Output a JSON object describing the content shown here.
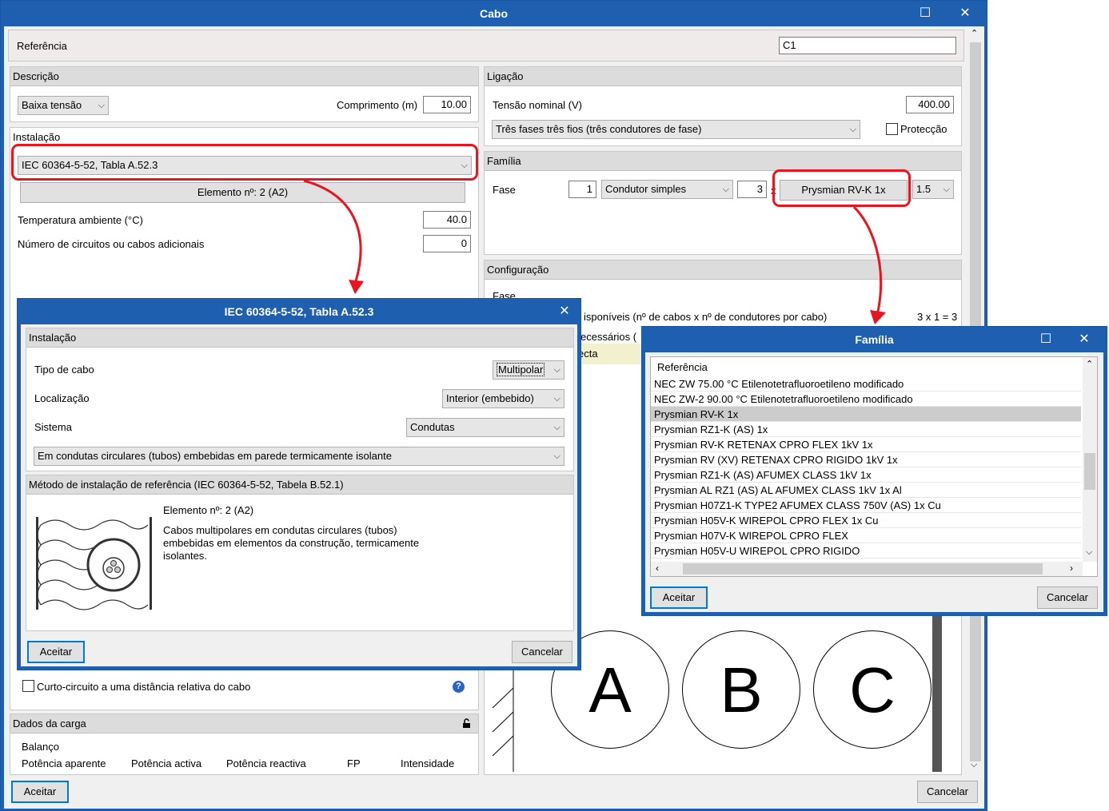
{
  "main": {
    "title": "Cabo",
    "referencia_label": "Referência",
    "referencia_value": "C1",
    "descricao": {
      "header": "Descrição",
      "tipo": "Baixa tensão",
      "comprimento_label": "Comprimento (m)",
      "comprimento_value": "10.00"
    },
    "instalacao": {
      "header": "Instalação",
      "norma": "IEC 60364-5-52, Tabla A.52.3",
      "elemento_button": "Elemento nº: 2 (A2)",
      "temp_label": "Temperatura ambiente (°C)",
      "temp_value": "40.0",
      "circuitos_label": "Número de circuitos ou cabos adicionais",
      "circuitos_value": "0",
      "curto_label": "Curto-circuito a uma distância relativa do cabo"
    },
    "ligacao": {
      "header": "Ligação",
      "tensao_label": "Tensão nominal (V)",
      "tensao_value": "400.00",
      "fases": "Três fases três fios (três condutores de fase)",
      "proteccao_label": "Protecção"
    },
    "familia": {
      "header": "Família",
      "fase_label": "Fase",
      "fase_count": "1",
      "condutor": "Condutor simples",
      "condutor_count": "3",
      "x_label": "x",
      "cabo": "Prysmian RV-K 1x",
      "seccao": "1.5"
    },
    "configuracao": {
      "header": "Configuração",
      "fase_label": "Fase",
      "disponiveis_label": "isponíveis (nº de cabos x nº de condutores por cabo)",
      "disponiveis_value": "3 x 1 = 3",
      "necessarios_label": "ecessários (",
      "correcta_label": "ecta"
    },
    "dados_carga": {
      "header": "Dados da carga",
      "balanco": "Balanço",
      "cols": [
        "Potência aparente",
        "Potência activa",
        "Potência reactiva",
        "FP",
        "Intensidade"
      ]
    },
    "drawing": {
      "labels": [
        "A",
        "B",
        "C"
      ]
    },
    "aceitar": "Aceitar",
    "cancelar": "Cancelar"
  },
  "iec_dialog": {
    "title": "IEC 60364-5-52, Tabla A.52.3",
    "instalacao_header": "Instalação",
    "tipo_cabo_label": "Tipo de cabo",
    "tipo_cabo_value": "Multipolar",
    "localizacao_label": "Localização",
    "localizacao_value": "Interior (embebido)",
    "sistema_label": "Sistema",
    "sistema_value": "Condutas",
    "descricao_value": "Em condutas circulares (tubos) embebidas em parede termicamente isolante",
    "metodo_header": "Método de instalação de referência (IEC 60364-5-52, Tabela B.52.1)",
    "elemento": "Elemento nº: 2 (A2)",
    "descricao_text": "Cabos multipolares em condutas circulares (tubos) embebidas em elementos da construção, termicamente isolantes.",
    "aceitar": "Aceitar",
    "cancelar": "Cancelar"
  },
  "familia_dialog": {
    "title": "Família",
    "column": "Referência",
    "items": [
      "NEC ZW 75.00 °C Etilenotetrafluoroetileno modificado",
      "NEC ZW-2 90.00 °C Etilenotetrafluoroetileno modificado",
      "Prysmian RV-K 1x",
      "Prysmian RZ1-K (AS) 1x",
      "Prysmian RV-K RETENAX CPRO FLEX 1kV 1x",
      "Prysmian RV (XV) RETENAX CPRO RIGIDO 1kV 1x",
      "Prysmian RZ1-K (AS) AFUMEX CLASS 1kV 1x",
      "Prysmian AL RZ1 (AS) AL AFUMEX CLASS 1kV 1x Al",
      "Prysmian H07Z1-K TYPE2 AFUMEX CLASS 750V (AS) 1x Cu",
      "Prysmian H05V-K WIREPOL CPRO FLEX 1x Cu",
      "Prysmian H07V-K WIREPOL CPRO FLEX",
      "Prysmian H05V-U WIREPOL CPRO RIGIDO"
    ],
    "selected_index": 2,
    "aceitar": "Aceitar",
    "cancelar": "Cancelar"
  },
  "colors": {
    "titlebar": "#1e5fb0",
    "highlight": "#e8141e",
    "default_button": "#0078d7"
  }
}
